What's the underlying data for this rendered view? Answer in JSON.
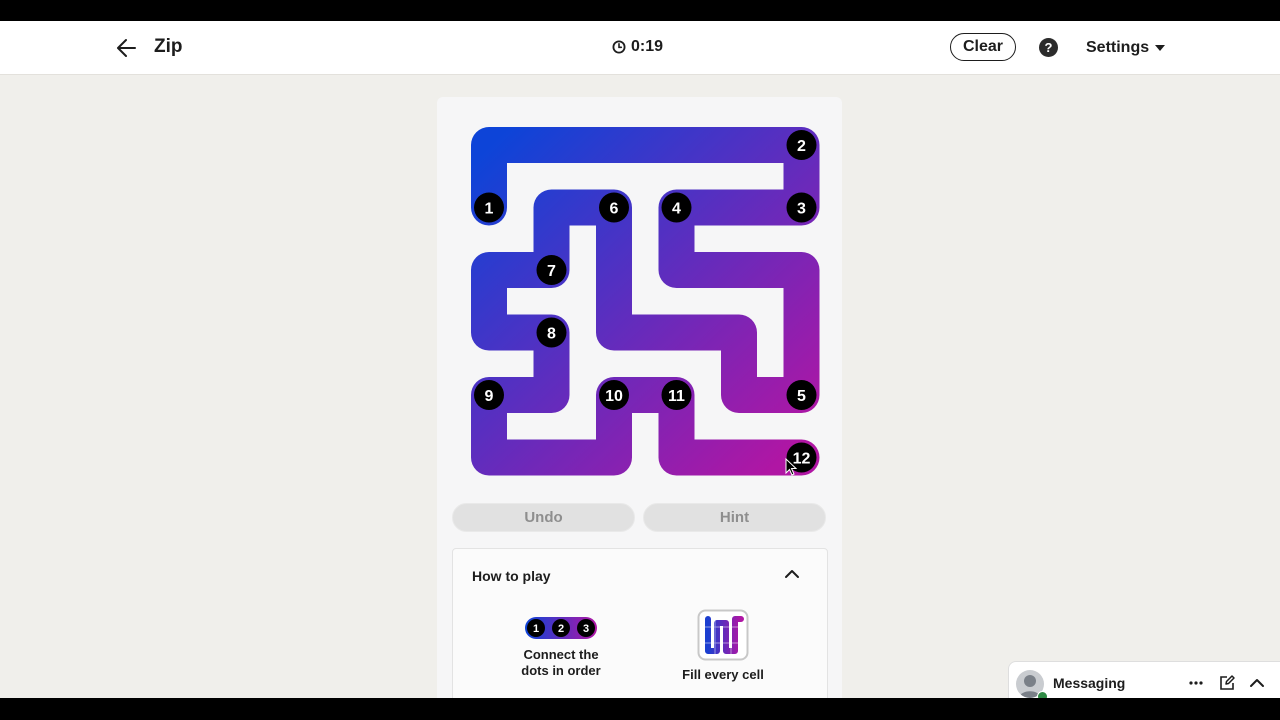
{
  "header": {
    "title": "Zip",
    "timer": "0:19",
    "clear_label": "Clear",
    "help_glyph": "?",
    "settings_label": "Settings",
    "icons": [
      "back-arrow-icon",
      "clock-icon",
      "help-icon",
      "caret-down-icon"
    ]
  },
  "game": {
    "grid_size": 6,
    "dots": [
      {
        "label": "1",
        "row": 1,
        "col": 0
      },
      {
        "label": "2",
        "row": 0,
        "col": 5
      },
      {
        "label": "3",
        "row": 1,
        "col": 5
      },
      {
        "label": "4",
        "row": 1,
        "col": 3
      },
      {
        "label": "5",
        "row": 4,
        "col": 5
      },
      {
        "label": "6",
        "row": 1,
        "col": 2
      },
      {
        "label": "7",
        "row": 2,
        "col": 1
      },
      {
        "label": "8",
        "row": 3,
        "col": 1
      },
      {
        "label": "9",
        "row": 4,
        "col": 0
      },
      {
        "label": "10",
        "row": 4,
        "col": 2
      },
      {
        "label": "11",
        "row": 4,
        "col": 3
      },
      {
        "label": "12",
        "row": 5,
        "col": 5
      }
    ],
    "path": [
      [
        1,
        0
      ],
      [
        0,
        0
      ],
      [
        0,
        1
      ],
      [
        0,
        2
      ],
      [
        0,
        3
      ],
      [
        0,
        4
      ],
      [
        0,
        5
      ],
      [
        1,
        5
      ],
      [
        1,
        4
      ],
      [
        1,
        3
      ],
      [
        2,
        3
      ],
      [
        2,
        4
      ],
      [
        2,
        5
      ],
      [
        3,
        5
      ],
      [
        4,
        5
      ],
      [
        4,
        4
      ],
      [
        3,
        4
      ],
      [
        3,
        3
      ],
      [
        3,
        2
      ],
      [
        2,
        2
      ],
      [
        1,
        2
      ],
      [
        1,
        1
      ],
      [
        2,
        1
      ],
      [
        2,
        0
      ],
      [
        3,
        0
      ],
      [
        3,
        1
      ],
      [
        4,
        1
      ],
      [
        4,
        0
      ],
      [
        5,
        0
      ],
      [
        5,
        1
      ],
      [
        5,
        2
      ],
      [
        4,
        2
      ],
      [
        4,
        3
      ],
      [
        5,
        3
      ],
      [
        5,
        4
      ],
      [
        5,
        5
      ]
    ],
    "path_colors": {
      "start": "#0d44d8",
      "end": "#b016a4"
    },
    "dot_color": "#000000",
    "undo_label": "Undo",
    "hint_label": "Hint"
  },
  "how_to_play": {
    "title": "How to play",
    "steps": [
      {
        "caption": "Connect the\ndots in order",
        "dot_labels": [
          "1",
          "2",
          "3"
        ],
        "icon": "numbered-dots-icon"
      },
      {
        "caption": "Fill every cell",
        "icon": "fill-grid-icon"
      }
    ],
    "collapse_icon": "chevron-up-icon"
  },
  "messaging": {
    "label": "Messaging",
    "icons": [
      "avatar",
      "more-icon",
      "compose-icon",
      "chevron-up-icon"
    ],
    "status_color": "#2f8a45"
  }
}
